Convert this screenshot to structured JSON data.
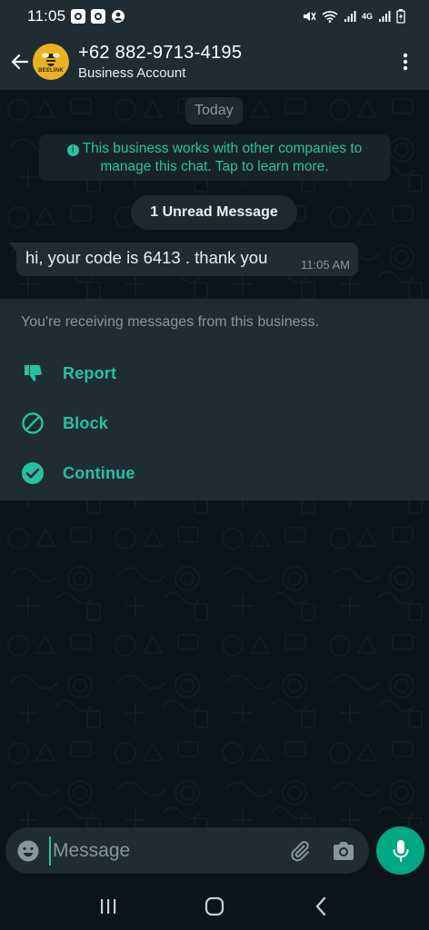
{
  "status_bar": {
    "time": "11:05",
    "network": "4G"
  },
  "header": {
    "contact_name": "+62 882-9713-4195",
    "subtitle": "Business Account",
    "avatar_brand": "BEELINK",
    "icons": [
      "back-arrow-icon",
      "kebab-menu-icon"
    ]
  },
  "chat": {
    "date_chip": "Today",
    "business_notice": "This business works with other companies to manage this chat. Tap to learn more.",
    "unread_label": "1 Unread Message",
    "messages": [
      {
        "text": "hi, your code is 6413 . thank you",
        "time": "11:05 AM",
        "direction": "incoming"
      }
    ]
  },
  "business_panel": {
    "info": "You're receiving messages from this business.",
    "actions": [
      {
        "label": "Report",
        "icon": "thumbs-down-icon"
      },
      {
        "label": "Block",
        "icon": "block-icon"
      },
      {
        "label": "Continue",
        "icon": "check-circle-icon"
      }
    ]
  },
  "composer": {
    "placeholder": "Message",
    "value": "",
    "icons": [
      "emoji-icon",
      "attach-icon",
      "camera-icon",
      "mic-icon"
    ]
  },
  "nav_bar": {
    "icons": [
      "recents-icon",
      "home-icon",
      "back-icon"
    ]
  },
  "colors": {
    "accent": "#00a884",
    "accent_text": "#27c1a4",
    "background": "#0b141a",
    "bar": "#1f2c34",
    "bubble": "#202c33"
  }
}
